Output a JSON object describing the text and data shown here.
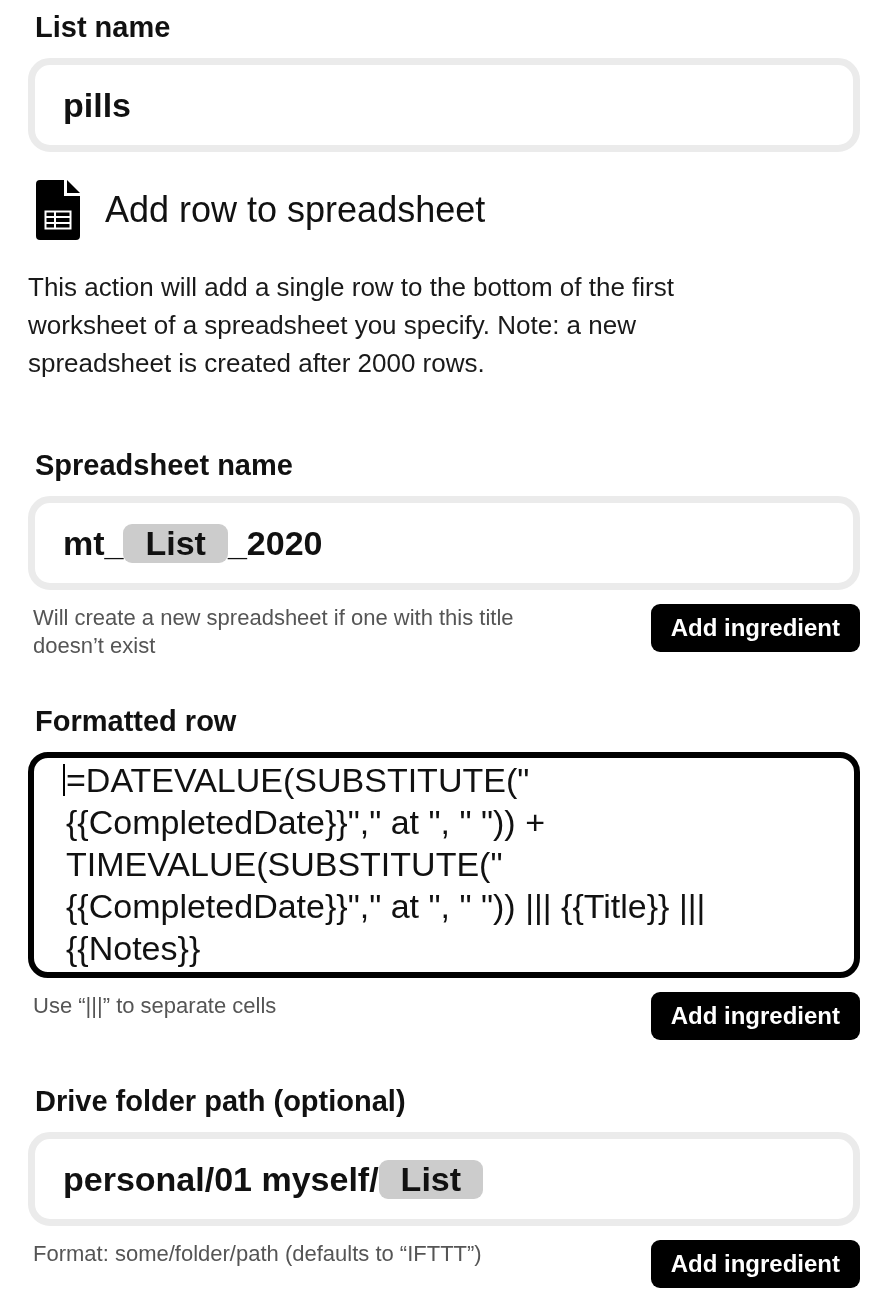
{
  "list_name": {
    "label": "List name",
    "field": {
      "kind": "input",
      "focused": false,
      "value": [
        {
          "kind": "text",
          "text": "pills"
        }
      ]
    }
  },
  "action": {
    "title": "Add row to spreadsheet",
    "description": "This action will add a single row to the bottom of the first worksheet of a spreadsheet you specify. Note: a new spreadsheet is created after 2000 rows."
  },
  "fields": [
    {
      "label": "Spreadsheet name",
      "field": {
        "kind": "input",
        "focused": false,
        "value": [
          {
            "kind": "text",
            "text": "mt_"
          },
          {
            "kind": "ingredient",
            "text": "List"
          },
          {
            "kind": "text",
            "text": "_2020"
          }
        ]
      },
      "help": "Will create a new spreadsheet if one with this title doesn’t exist",
      "button": "Add ingredient"
    },
    {
      "label": "Formatted row",
      "field": {
        "kind": "textarea",
        "focused": true,
        "value": [
          {
            "kind": "text",
            "text": "=DATEVALUE(SUBSTITUTE(\"\n{{CompletedDate}}\",\" at \", \" \")) +\nTIMEVALUE(SUBSTITUTE(\"\n{{CompletedDate}}\",\" at \", \" \")) ||| {{Title}} |||\n{{Notes}}"
          }
        ]
      },
      "help": "Use “|||” to separate cells",
      "button": "Add ingredient"
    },
    {
      "label": "Drive folder path (optional)",
      "field": {
        "kind": "input",
        "focused": false,
        "value": [
          {
            "kind": "text",
            "text": "personal/01 myself/"
          },
          {
            "kind": "ingredient",
            "text": "List"
          }
        ]
      },
      "help": "Format: some/folder/path (defaults to “IFTTT”)",
      "button": "Add ingredient"
    }
  ]
}
